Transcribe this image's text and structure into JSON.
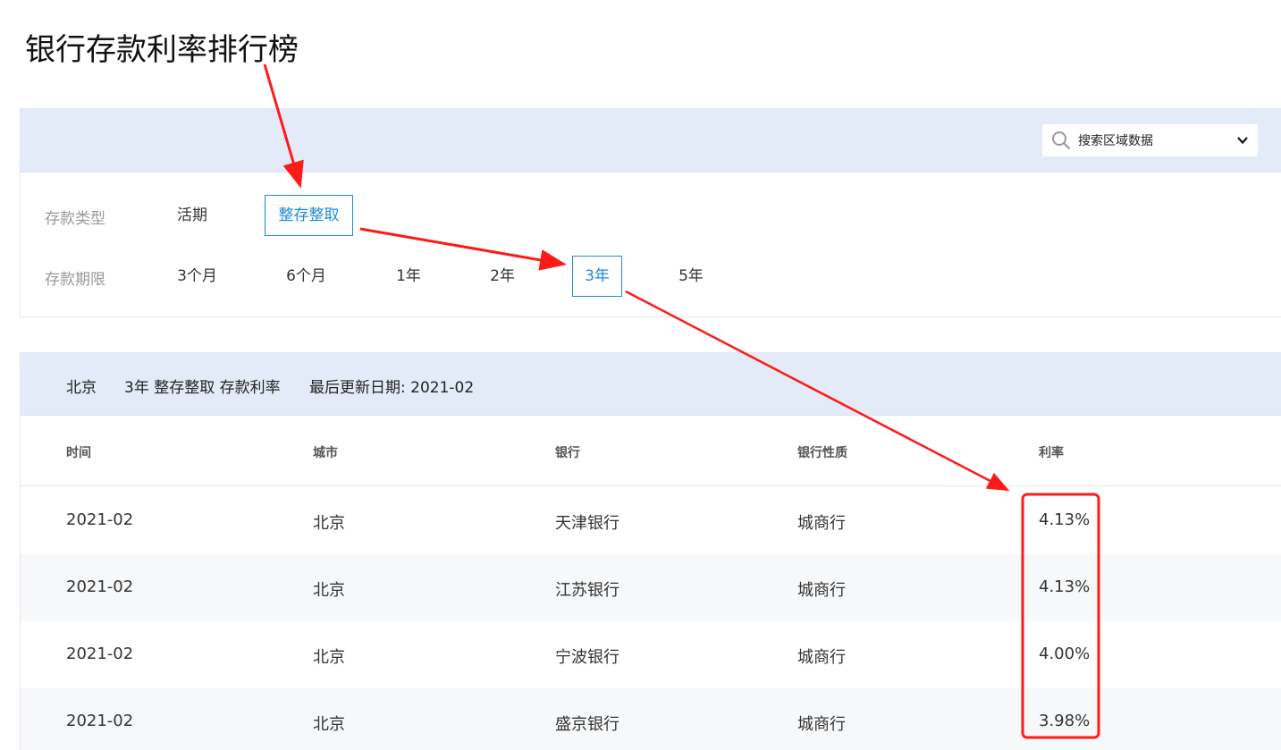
{
  "page": {
    "title": "银行存款利率排行榜"
  },
  "search": {
    "label": "搜索区域数据",
    "icon": "search-icon"
  },
  "filters": {
    "deposit_type": {
      "label": "存款类型",
      "options": [
        "活期",
        "整存整取"
      ],
      "selected": "整存整取"
    },
    "deposit_term": {
      "label": "存款期限",
      "options": [
        "3个月",
        "6个月",
        "1年",
        "2年",
        "3年",
        "5年"
      ],
      "selected": "3年"
    }
  },
  "result": {
    "city": "北京",
    "description": "3年 整存整取 存款利率",
    "updated": "最后更新日期: 2021-02"
  },
  "table": {
    "columns": [
      "时间",
      "城市",
      "银行",
      "银行性质",
      "利率"
    ],
    "rows": [
      [
        "2021-02",
        "北京",
        "天津银行",
        "城商行",
        "4.13%"
      ],
      [
        "2021-02",
        "北京",
        "江苏银行",
        "城商行",
        "4.13%"
      ],
      [
        "2021-02",
        "北京",
        "宁波银行",
        "城商行",
        "4.00%"
      ],
      [
        "2021-02",
        "北京",
        "盛京银行",
        "城商行",
        "3.98%"
      ]
    ]
  },
  "colors": {
    "accent": "#1f8ad6",
    "header_bg": "#e3ebf8",
    "annotation": "#ff1a1a"
  }
}
